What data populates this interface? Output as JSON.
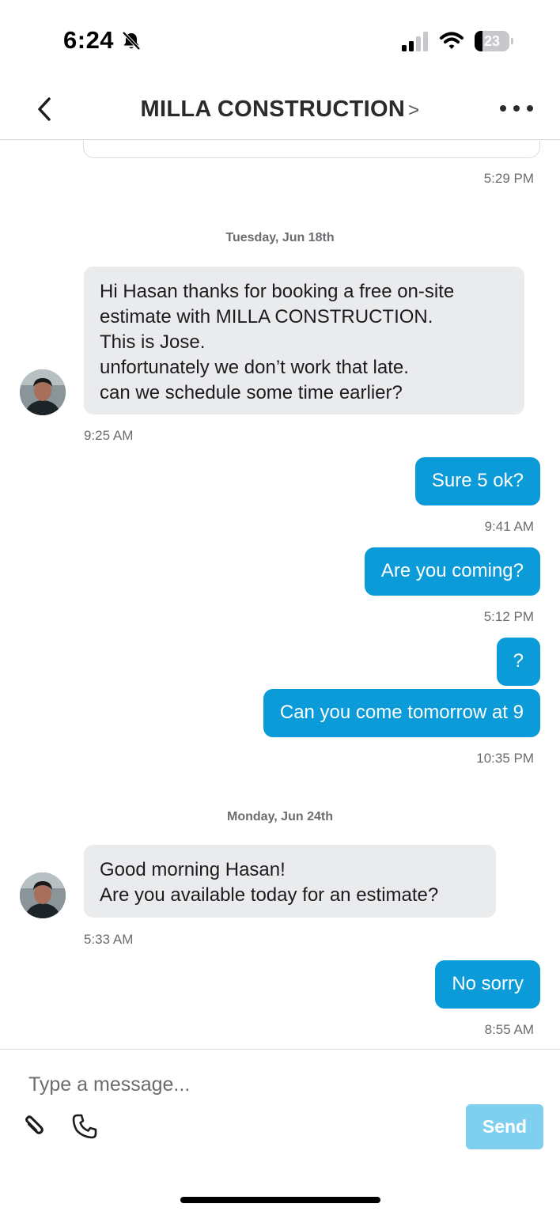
{
  "status_bar": {
    "time": "6:24",
    "battery_level": "23",
    "battery_fraction": 0.23,
    "icons": [
      "bell-slash-icon",
      "cellular-signal-icon",
      "wifi-icon",
      "battery-icon"
    ]
  },
  "header": {
    "title": "MILLA CONSTRUCTION",
    "chevron": ">",
    "back_icon": "chevron-left-icon",
    "more_icon": "ellipsis-icon"
  },
  "messages": {
    "prev_time": "5:29 PM",
    "dates": [
      "Tuesday, Jun 18th",
      "Monday, Jun 24th"
    ],
    "list": [
      {
        "direction": "incoming",
        "lines": [
          "Hi Hasan thanks for booking a free on-site",
          "estimate with MILLA CONSTRUCTION.",
          "This is Jose.",
          "unfortunately we don’t work that late.",
          "can we schedule some time earlier?"
        ],
        "time": "9:25 AM"
      },
      {
        "direction": "outgoing",
        "text": "Sure 5 ok?",
        "time": "9:41 AM"
      },
      {
        "direction": "outgoing",
        "text": "Are you coming?",
        "time": "5:12 PM"
      },
      {
        "direction": "outgoing",
        "text": "?",
        "time": ""
      },
      {
        "direction": "outgoing",
        "text": "Can you come tomorrow at 9",
        "time": "10:35 PM"
      },
      {
        "direction": "incoming",
        "lines": [
          "Good morning Hasan!",
          "Are you available today for an estimate?"
        ],
        "time": "5:33 AM"
      },
      {
        "direction": "outgoing",
        "text": "No sorry",
        "time": "8:55 AM"
      }
    ]
  },
  "composer": {
    "placeholder": "Type a message...",
    "send_label": "Send",
    "attach_icon": "paperclip-icon",
    "phone_icon": "phone-icon"
  },
  "colors": {
    "outgoing_bubble": "#0a9bd8",
    "incoming_bubble": "#e9ebec",
    "send_button": "#7fd0ef"
  }
}
